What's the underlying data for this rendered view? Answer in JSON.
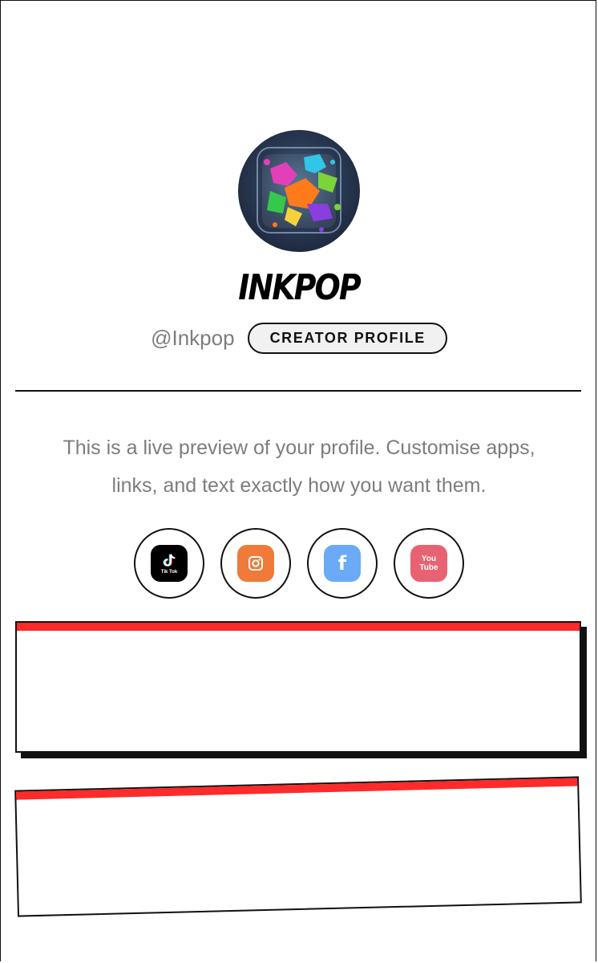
{
  "profile": {
    "name": "INKPOP",
    "handle": "@Inkpop",
    "badge": "CREATOR PROFILE",
    "avatar_icon": "paint-splash-icon"
  },
  "description": "This is a live preview of your profile. Customise apps, links, and text exactly how you want them.",
  "socials": [
    {
      "name": "TikTok",
      "icon": "tiktok-icon",
      "color": "#000000",
      "label": "Tik Tok"
    },
    {
      "name": "Instagram",
      "icon": "instagram-icon",
      "color": "#f07a3a"
    },
    {
      "name": "Facebook",
      "icon": "facebook-icon",
      "color": "#6aaaf7",
      "label": "f"
    },
    {
      "name": "YouTube",
      "icon": "youtube-icon",
      "color": "#e86371",
      "label": "You Tube"
    }
  ],
  "colors": {
    "accent": "#ff2a2a",
    "text_muted": "#7d7d7d",
    "border": "#111111"
  }
}
